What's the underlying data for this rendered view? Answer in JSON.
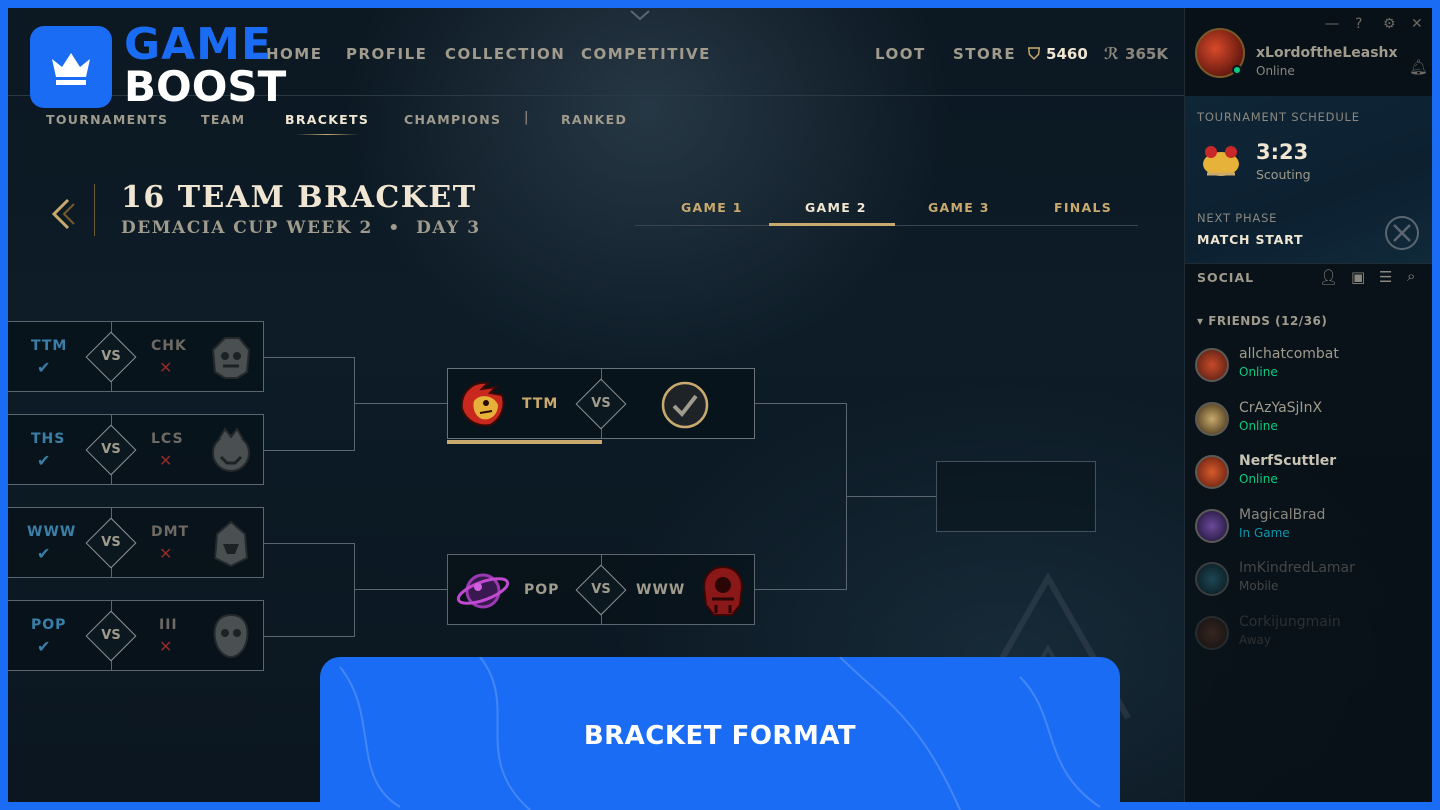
{
  "brand": {
    "line1": "GAME",
    "line2": "BOOST",
    "color": "#1a6cf5"
  },
  "nav": {
    "items": [
      "HOME",
      "PROFILE",
      "COLLECTION",
      "COMPETITIVE",
      "LOOT",
      "STORE"
    ],
    "blue_essence": "5460",
    "riot_points": "365K"
  },
  "subnav": {
    "items": [
      "TOURNAMENTS",
      "TEAM",
      "BRACKETS",
      "CHAMPIONS",
      "RANKED"
    ],
    "active": "BRACKETS",
    "separator": "|"
  },
  "title": {
    "main": "16 TEAM BRACKET",
    "event": "DEMACIA CUP WEEK 2",
    "dot": "•",
    "day": "DAY 3"
  },
  "game_tabs": [
    "GAME 1",
    "GAME 2",
    "GAME 3",
    "FINALS"
  ],
  "active_game_tab": "GAME 2",
  "bracket": {
    "round1": [
      {
        "team_a": "TTM",
        "team_b": "CHK",
        "vs": "VS"
      },
      {
        "team_a": "THS",
        "team_b": "LCS",
        "vs": "VS"
      },
      {
        "team_a": "WWW",
        "team_b": "DMT",
        "vs": "VS"
      },
      {
        "team_a": "POP",
        "team_b": "III",
        "vs": "VS"
      }
    ],
    "round2": [
      {
        "team_a": "TTM",
        "vs": "VS"
      },
      {
        "team_a": "POP",
        "team_b": "WWW",
        "vs": "VS"
      }
    ]
  },
  "profile": {
    "name": "xLordoftheLeashx",
    "status": "Online"
  },
  "schedule": {
    "label": "TOURNAMENT SCHEDULE",
    "time": "3:23",
    "phase": "Scouting",
    "next_label": "NEXT PHASE",
    "next_value": "MATCH START"
  },
  "social": {
    "label": "SOCIAL",
    "group": "FRIENDS (12/36)",
    "friends": [
      {
        "name": "allchatcombat",
        "status": "Online",
        "color": "#0acb82"
      },
      {
        "name": "CrAzYaSjInX",
        "status": "Online",
        "color": "#0acb82"
      },
      {
        "name": "NerfScuttler",
        "status": "Online",
        "color": "#0acb82"
      },
      {
        "name": "MagicalBrad",
        "status": "In Game",
        "color": "#0a96aa"
      },
      {
        "name": "ImKindredLamar",
        "status": "Mobile",
        "color": "#6e6a63"
      },
      {
        "name": "Corkijungmain",
        "status": "Away",
        "color": "#6e6a63"
      }
    ]
  },
  "banner": {
    "text": "BRACKET FORMAT"
  }
}
